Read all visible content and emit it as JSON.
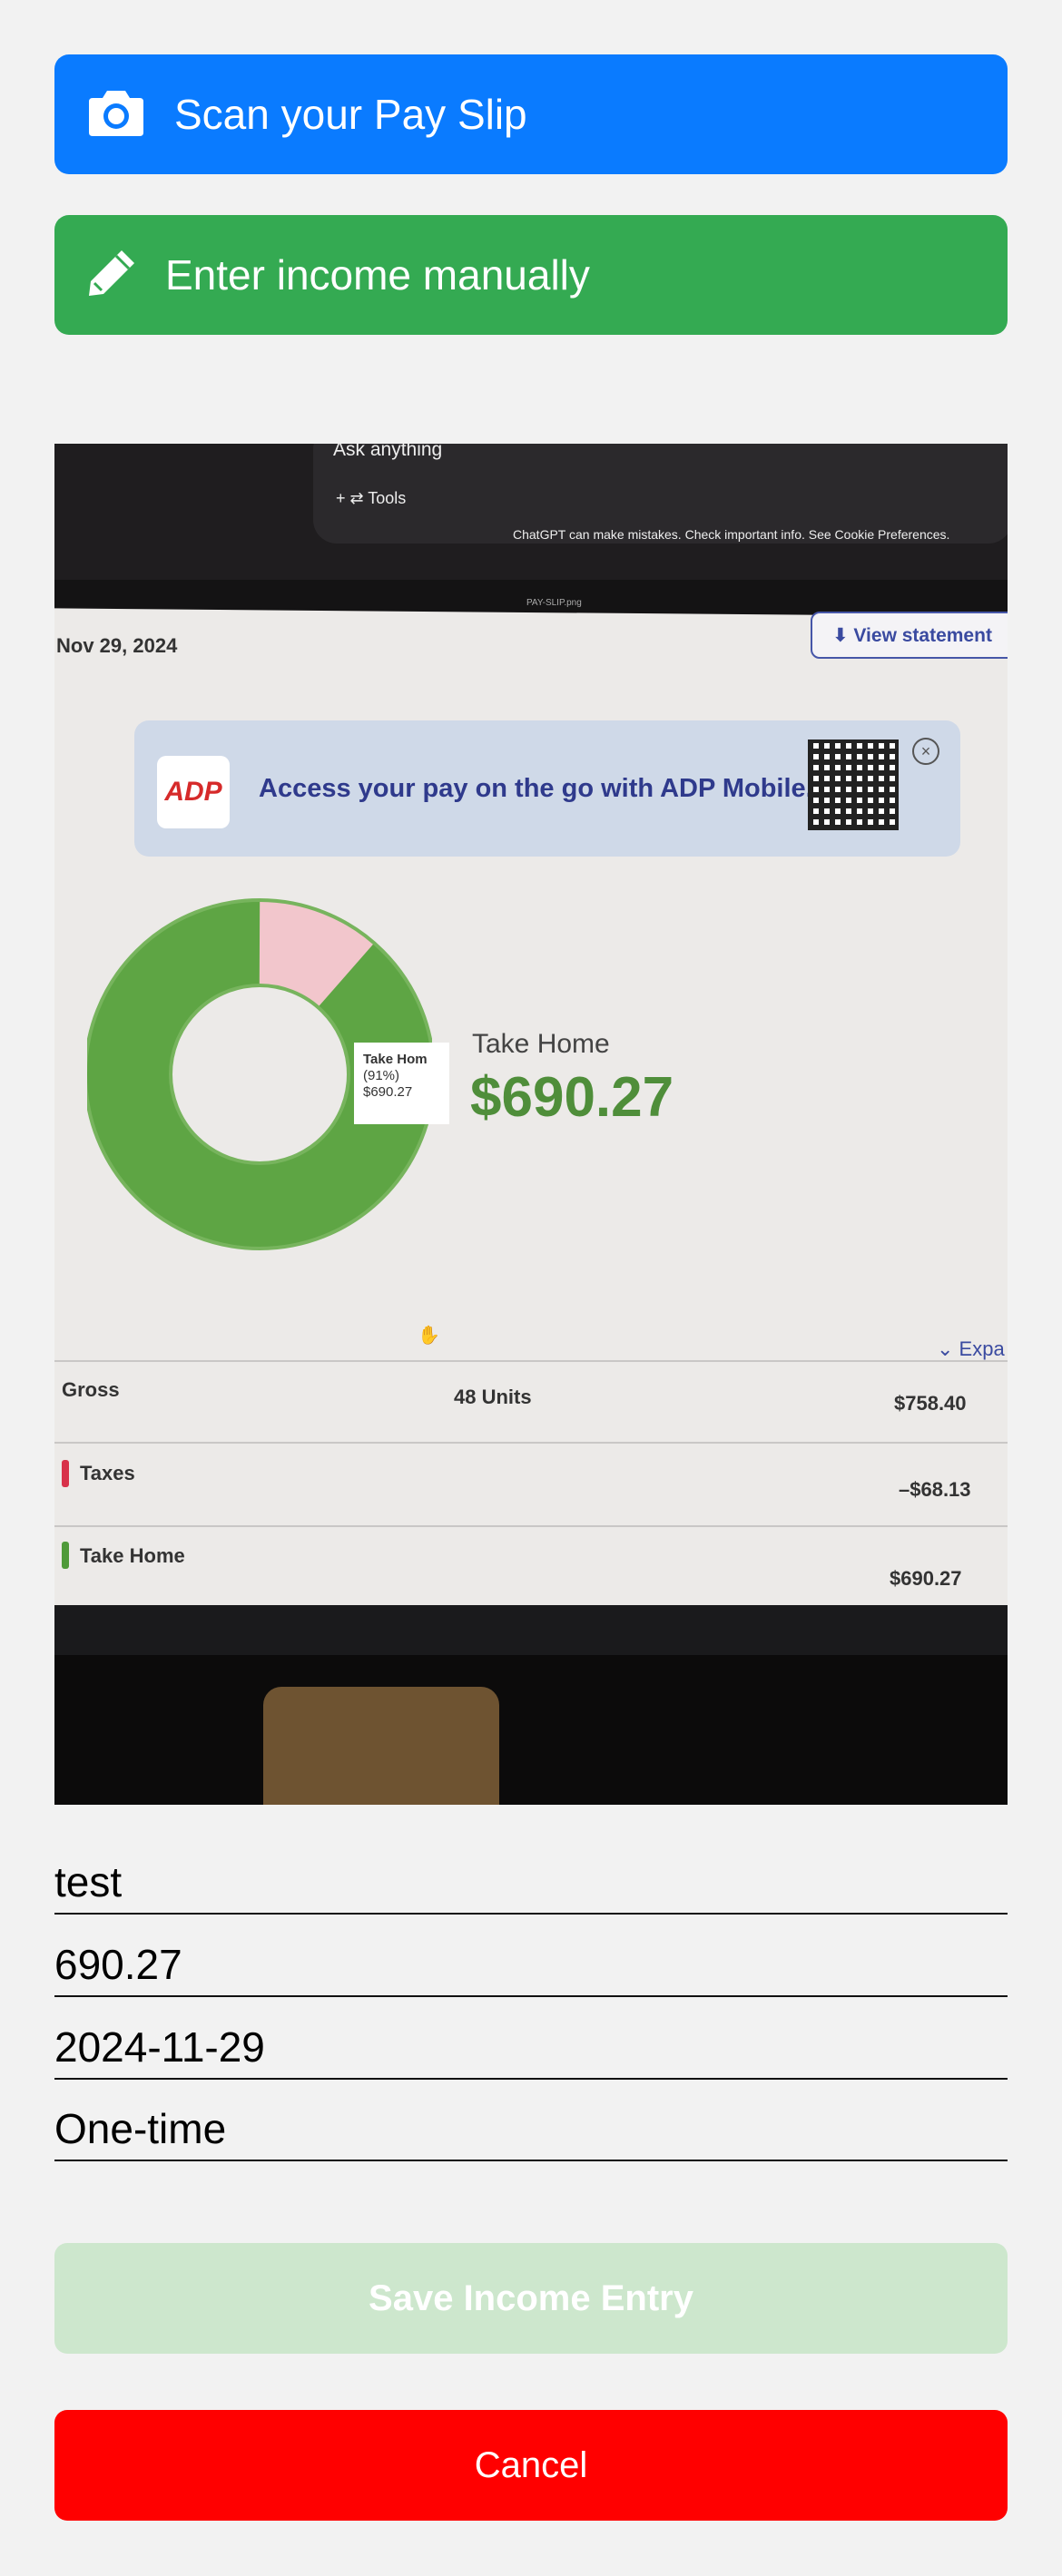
{
  "actions": {
    "scan_label": "Scan your Pay Slip",
    "manual_label": "Enter income manually"
  },
  "photo": {
    "chat_prompt": "Ask anything",
    "chat_tools": "+   ⇄ Tools",
    "chat_disclaimer": "ChatGPT can make mistakes. Check important info. See Cookie Preferences.",
    "filename": "PAY-SLIP.png",
    "date": "Nov 29, 2024",
    "view_statement": "⬇ View statement",
    "adp_logo": "ADP",
    "adp_banner": "Access your pay on the go with ADP Mobile.",
    "tooltip": [
      "Take Hom",
      "(91%)",
      "$690.27"
    ],
    "take_home_label": "Take Home",
    "take_home_amount": "$690.27",
    "expand": "⌄ Expa",
    "rows": [
      {
        "label": "Gross",
        "units": "48 Units",
        "value": "$758.40"
      },
      {
        "label": "Taxes",
        "units": "",
        "value": "–$68.13"
      },
      {
        "label": "Take Home",
        "units": "",
        "value": "$690.27"
      }
    ]
  },
  "form": {
    "name": "test",
    "amount": "690.27",
    "date": "2024-11-29",
    "frequency": "One-time"
  },
  "buttons": {
    "save": "Save Income Entry",
    "cancel": "Cancel"
  }
}
